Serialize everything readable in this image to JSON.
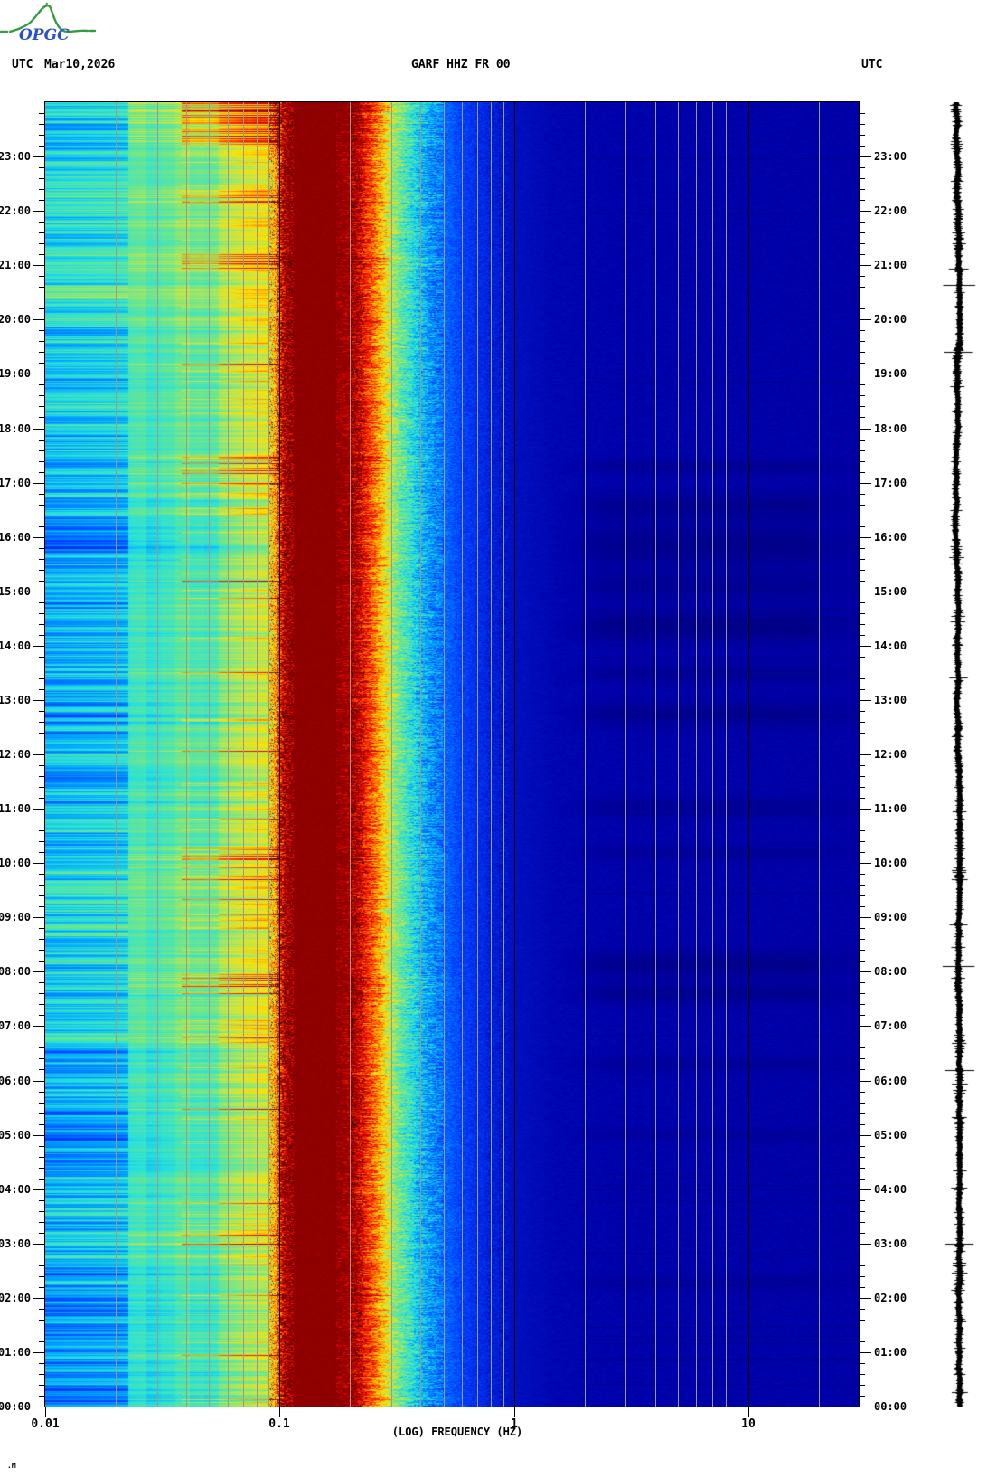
{
  "header": {
    "utc_left": "UTC",
    "date": "Mar10,2026",
    "station_title": "GARF HHZ FR 00",
    "utc_right": "UTC"
  },
  "logo": {
    "text": "OPGC"
  },
  "watermark": ".M",
  "axes": {
    "x_label": "(LOG) FREQUENCY (HZ)",
    "x_ticks": [
      {
        "f": 0.01,
        "label": "0.01"
      },
      {
        "f": 0.1,
        "label": "0.1"
      },
      {
        "f": 1,
        "label": "1"
      },
      {
        "f": 10,
        "label": "10"
      }
    ],
    "grid_multipliers": [
      2,
      3,
      4,
      5,
      6,
      7,
      8,
      9
    ],
    "extra_grid_hz": [
      20
    ],
    "decade_lines_hz": [
      0.1,
      1,
      10
    ],
    "hour_labels": [
      "00:00",
      "01:00",
      "02:00",
      "03:00",
      "04:00",
      "05:00",
      "06:00",
      "07:00",
      "08:00",
      "09:00",
      "10:00",
      "11:00",
      "12:00",
      "13:00",
      "14:00",
      "15:00",
      "16:00",
      "17:00",
      "18:00",
      "19:00",
      "20:00",
      "21:00",
      "22:00",
      "23:00"
    ],
    "minor_tick_minutes": 12
  },
  "colors": {
    "background": "#ffffff",
    "grid": "#9a9a8a",
    "decade_line": "#000000",
    "frame": "#000000",
    "text": "#000000",
    "logo_green": "#3a9a40",
    "logo_blue": "#2b50cc",
    "trace": "#000000",
    "maroon_peak": "#8b0000",
    "navy_floor": "#0000a8"
  },
  "chart_data": {
    "type": "heatmap",
    "title": "GARF HHZ FR 00",
    "subtitle_date": "Mar10,2026 UTC",
    "xlabel": "(LOG) FREQUENCY (HZ)",
    "x_scale": "log",
    "x_range_hz": [
      0.01,
      29.6
    ],
    "y_axis": "UTC time of day, 00:00 at bottom to 24:00 at top",
    "y_range_hours": [
      0,
      24
    ],
    "colormap": "jet-like: navy = low power, dark red = high power",
    "colormap_stops": [
      [
        0.0,
        "#00006e"
      ],
      [
        0.05,
        "#0000a8"
      ],
      [
        0.2,
        "#003cff"
      ],
      [
        0.32,
        "#00a0ff"
      ],
      [
        0.42,
        "#28e1dc"
      ],
      [
        0.52,
        "#6ee68c"
      ],
      [
        0.6,
        "#bee650"
      ],
      [
        0.68,
        "#ffe100"
      ],
      [
        0.76,
        "#ff8c00"
      ],
      [
        0.84,
        "#ff2800"
      ],
      [
        0.92,
        "#c80000"
      ],
      [
        1.0,
        "#8b0000"
      ]
    ],
    "power_profile_f_v": [
      [
        0.01,
        0.44
      ],
      [
        0.02,
        0.46
      ],
      [
        0.03,
        0.5
      ],
      [
        0.04,
        0.52
      ],
      [
        0.05,
        0.545
      ],
      [
        0.06,
        0.575
      ],
      [
        0.07,
        0.62
      ],
      [
        0.08,
        0.66
      ],
      [
        0.09,
        0.67
      ],
      [
        0.095,
        0.71
      ],
      [
        0.1,
        0.86
      ],
      [
        0.105,
        0.96
      ],
      [
        0.11,
        1.0
      ],
      [
        0.18,
        1.0
      ],
      [
        0.2,
        0.97
      ],
      [
        0.22,
        0.9
      ],
      [
        0.25,
        0.8
      ],
      [
        0.28,
        0.68
      ],
      [
        0.3,
        0.58
      ],
      [
        0.33,
        0.5
      ],
      [
        0.36,
        0.44
      ],
      [
        0.4,
        0.36
      ],
      [
        0.45,
        0.3
      ],
      [
        0.5,
        0.26
      ],
      [
        0.6,
        0.2
      ],
      [
        0.8,
        0.13
      ],
      [
        1.0,
        0.09
      ],
      [
        1.5,
        0.065
      ],
      [
        2.5,
        0.055
      ],
      [
        29.6,
        0.05
      ]
    ],
    "microseism_band_hz": [
      0.1,
      0.2
    ],
    "blue_time_windows_utc": [
      [
        0,
        2.6
      ],
      [
        4.3,
        6.6
      ],
      [
        10.0,
        16.3
      ]
    ],
    "bright_line_windows_utc": [
      [
        23.2,
        24
      ],
      [
        22.05,
        22.35
      ],
      [
        20.85,
        21.3
      ],
      [
        16.95,
        17.5
      ],
      [
        9.9,
        10.3
      ],
      [
        7.6,
        8.0
      ],
      [
        2.9,
        3.3
      ]
    ],
    "dark_events_t_dur_amp": [
      [
        16.6,
        0.5,
        0.035
      ],
      [
        15.85,
        0.8,
        0.04
      ],
      [
        15.1,
        0.5,
        0.03
      ],
      [
        14.35,
        0.6,
        0.045
      ],
      [
        13.5,
        0.4,
        0.03
      ],
      [
        12.75,
        0.5,
        0.035
      ],
      [
        11.05,
        0.35,
        0.03
      ],
      [
        10.2,
        0.3,
        0.025
      ],
      [
        8.15,
        0.5,
        0.04
      ],
      [
        7.6,
        0.4,
        0.035
      ],
      [
        6.3,
        0.3,
        0.025
      ],
      [
        17.3,
        0.3,
        0.03
      ],
      [
        5.0,
        0.25,
        0.02
      ],
      [
        2.3,
        0.3,
        0.02
      ]
    ],
    "dark_event_freq_range_hz": [
      1.8,
      22
    ],
    "right_margin": "vertical 24-h seismogram amplitude trace (black)"
  }
}
